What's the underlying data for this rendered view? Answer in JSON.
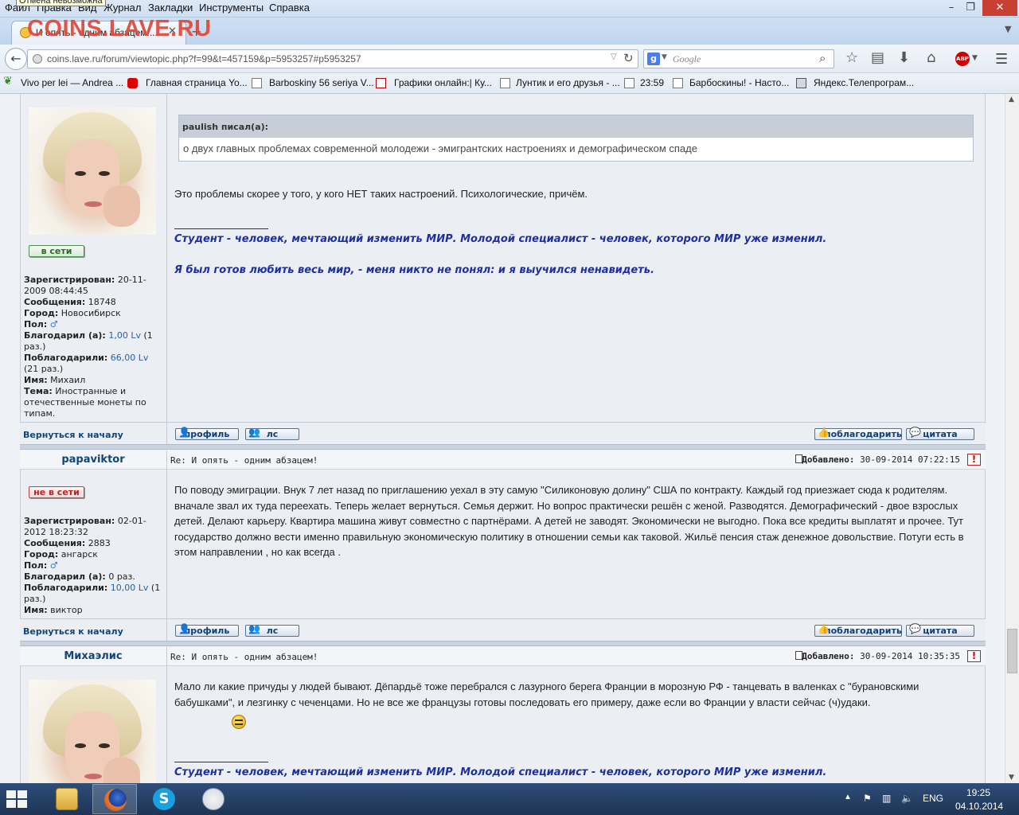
{
  "browser": {
    "tooltip": "Отмена невозможна",
    "menu": [
      "Файл",
      "Правка",
      "Вид",
      "Журнал",
      "Закладки",
      "Инструменты",
      "Справка"
    ],
    "tab_title": "И опять - одним абзацем!...",
    "watermark": "COINS.LAVE.RU",
    "url": "coins.lave.ru/forum/viewtopic.php?f=99&t=457159&p=5953257#p5953257",
    "search_placeholder": "Google",
    "bookmarks": [
      "Vivo per lei — Andrea ...",
      "Главная страница Yo...",
      "Barboskiny 56 seriya V...",
      "Графики онлайн:| Ку...",
      "Лунтик и его друзья - ...",
      "23:59",
      "Барбоскины! - Насто...",
      "Яндекс.Телепрограм..."
    ],
    "icons": [
      "back-arrow-icon",
      "reload-icon",
      "search-icon",
      "star-icon",
      "reading-list-icon",
      "download-icon",
      "home-icon",
      "adblock-icon",
      "menu-icon"
    ]
  },
  "post1": {
    "status": "в сети",
    "profile": {
      "registered_label": "Зарегистрирован:",
      "registered": "20-11-2009 08:44:45",
      "messages_label": "Сообщения:",
      "messages": "18748",
      "city_label": "Город:",
      "city": "Новосибирск",
      "gender_label": "Пол:",
      "gender": "♂",
      "thanked_label": "Благодарил (а):",
      "thanked_amount": "1,00 Lv",
      "thanked_times": "(1 раз.)",
      "was_thanked_label": "Поблагодарили:",
      "was_thanked_amount": "66,00 Lv",
      "was_thanked_times": "(21 раз.)",
      "name_label": "Имя:",
      "name": "Михаил",
      "theme_label": "Тема:",
      "theme": "Иностранные и отечественные монеты по типам."
    },
    "quote_author": "paulish писал(а):",
    "quote_text": "о двух главных проблемах современной молодежи - эмигрантских настроениях и демографическом спаде",
    "text": "Это проблемы скорее у того, у кого НЕТ таких настроений. Психологические, причём.",
    "signature_1": "Студент - человек, мечтающий изменить МИР. Молодой специалист - человек, которого МИР уже изменил.",
    "signature_2": "Я был готов любить весь мир, - меня никто не понял: и я выучился ненавидеть."
  },
  "post2": {
    "username": "papaviktor",
    "title": "Re: И опять - одним абзацем!",
    "added_label": "Добавлено:",
    "added": "30-09-2014 07:22:15",
    "status": "не в сети",
    "profile": {
      "registered_label": "Зарегистрирован:",
      "registered": "02-01-2012 18:23:32",
      "messages_label": "Сообщения:",
      "messages": "2883",
      "city_label": "Город:",
      "city": "ангарск",
      "gender_label": "Пол:",
      "gender": "♂",
      "thanked_label": "Благодарил (а):",
      "thanked": "0 раз.",
      "was_thanked_label": "Поблагодарили:",
      "was_thanked_amount": "10,00 Lv",
      "was_thanked_times": "(1 раз.)",
      "name_label": "Имя:",
      "name": "виктор"
    },
    "text": "По поводу эмиграции. Внук 7 лет назад по приглашению уехал в эту самую \"Силиконовую долину\" США по контракту. Каждый год приезжает сюда к родителям. вначале звал их туда переехать. Теперь желает вернуться. Семья держит. Но вопрос практически решён с женой. Разводятся. Демографический - двое взрослых детей. Делают карьеру. Квартира машина живут совместно с партнёрами. А детей не заводят. Экономически не выгодно. Пока все кредиты выплатят и прочее. Тут государство должно вести именно правильную экономическую политику в отношении семьи как таковой. Жильё пенсия стаж денежное довольствие. Потуги есть в этом направлении , но как всегда ."
  },
  "post3": {
    "username": "Михаэлис",
    "title": "Re: И опять - одним абзацем!",
    "added_label": "Добавлено:",
    "added": "30-09-2014 10:35:35",
    "text": "Мало ли какие причуды у людей бывают. Дёпардьё тоже перебрался с лазурного берега Франции в морозную РФ - танцевать в валенках с \"бурановскими бабушками\", и лезгинку с чеченцами. Но не все же французы готовы последовать его примеру, даже если во Франции у власти сейчас (ч)удаки.",
    "signature_1": "Студент - человек, мечтающий изменить МИР. Молодой специалист - человек, которого МИР уже изменил."
  },
  "actions": {
    "back_to_top": "Вернуться к началу",
    "profile": "профиль",
    "pm": "лс",
    "thank": "поблагодарить",
    "quote": "цитата"
  },
  "taskbar": {
    "language": "ENG",
    "time": "19:25",
    "date": "04.10.2014"
  }
}
